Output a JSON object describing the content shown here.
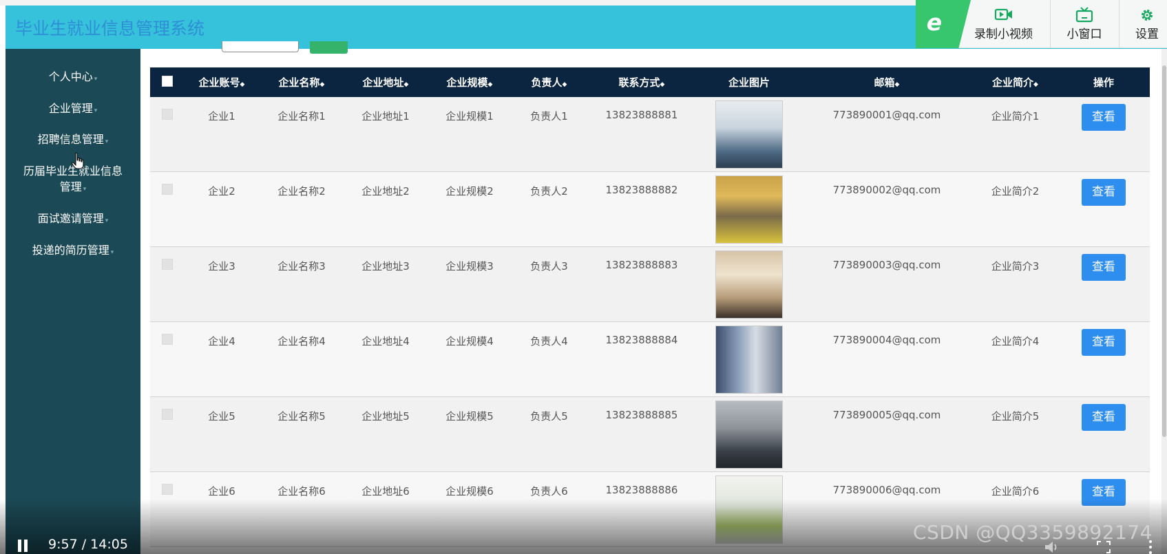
{
  "app": {
    "title": "毕业生就业信息管理系统"
  },
  "toolbar": {
    "record_label": "录制小视频",
    "mini_window_label": "小窗口",
    "settings_label": "设置"
  },
  "sidebar": {
    "items": [
      {
        "label": "个人中心"
      },
      {
        "label": "企业管理"
      },
      {
        "label": "招聘信息管理"
      },
      {
        "label": "历届毕业生就业信息"
      },
      {
        "label": "管理"
      },
      {
        "label": "面试邀请管理"
      },
      {
        "label": "投递的简历管理"
      }
    ]
  },
  "table": {
    "headers": [
      "企业账号",
      "企业名称",
      "企业地址",
      "企业规模",
      "负责人",
      "联系方式",
      "企业图片",
      "邮箱",
      "企业简介",
      "操作"
    ],
    "sort_glyph": "◆",
    "view_label": "查看",
    "rows": [
      {
        "account": "企业1",
        "name": "企业名称1",
        "address": "企业地址1",
        "scale": "企业规模1",
        "owner": "负责人1",
        "phone": "13823888881",
        "email": "773890001@qq.com",
        "intro": "企业简介1"
      },
      {
        "account": "企业2",
        "name": "企业名称2",
        "address": "企业地址2",
        "scale": "企业规模2",
        "owner": "负责人2",
        "phone": "13823888882",
        "email": "773890002@qq.com",
        "intro": "企业简介2"
      },
      {
        "account": "企业3",
        "name": "企业名称3",
        "address": "企业地址3",
        "scale": "企业规模3",
        "owner": "负责人3",
        "phone": "13823888883",
        "email": "773890003@qq.com",
        "intro": "企业简介3"
      },
      {
        "account": "企业4",
        "name": "企业名称4",
        "address": "企业地址4",
        "scale": "企业规模4",
        "owner": "负责人4",
        "phone": "13823888884",
        "email": "773890004@qq.com",
        "intro": "企业简介4"
      },
      {
        "account": "企业5",
        "name": "企业名称5",
        "address": "企业地址5",
        "scale": "企业规模5",
        "owner": "负责人5",
        "phone": "13823888885",
        "email": "773890005@qq.com",
        "intro": "企业简介5"
      },
      {
        "account": "企业6",
        "name": "企业名称6",
        "address": "企业地址6",
        "scale": "企业规模6",
        "owner": "负责人6",
        "phone": "13823888886",
        "email": "773890006@qq.com",
        "intro": "企业简介6"
      }
    ]
  },
  "video": {
    "time": "9:57 / 14:05",
    "watermark": "CSDN @QQ3359892174"
  },
  "colors": {
    "header": "#36c2da",
    "sidebar": "#1b4955",
    "table_head": "#0b2440",
    "view_button": "#2e8ef0",
    "accent_green": "#37c66e"
  }
}
